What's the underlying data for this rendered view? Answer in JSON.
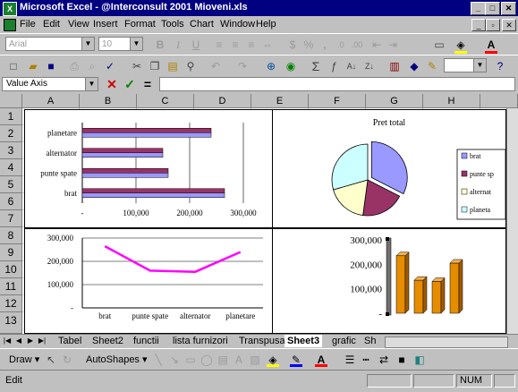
{
  "window": {
    "title": "Microsoft Excel - @Interconsult 2001 Mioveni.xls",
    "controls": [
      "minimize",
      "maximize",
      "close"
    ]
  },
  "menu": {
    "items": [
      "File",
      "Edit",
      "View",
      "Insert",
      "Format",
      "Tools",
      "Chart",
      "Window",
      "Help"
    ]
  },
  "formatting_toolbar": {
    "font": "Arial",
    "size": "10",
    "bold": "B",
    "italic": "I",
    "underline": "U",
    "currency": "$",
    "percent": "%",
    "comma": ","
  },
  "formula_bar": {
    "name_box": "Value Axis",
    "cancel": "✕",
    "enter": "✓",
    "equals": "=",
    "content": ""
  },
  "grid": {
    "columns": [
      "A",
      "B",
      "C",
      "D",
      "E",
      "F",
      "G",
      "H"
    ],
    "rows": [
      "1",
      "2",
      "3",
      "4",
      "5",
      "6",
      "7",
      "8",
      "9",
      "10",
      "11",
      "12",
      "13"
    ]
  },
  "chart_data": [
    {
      "type": "bar",
      "categories": [
        "brat",
        "punte spate",
        "alternator",
        "planetare"
      ],
      "series": [
        {
          "values": [
            265000,
            160000,
            150000,
            240000
          ],
          "color": "#993366"
        },
        {
          "values": [
            265000,
            160000,
            150000,
            240000
          ],
          "color": "#9999ff"
        }
      ],
      "xlim": [
        0,
        300000
      ],
      "xticks": [
        "-",
        "100,000",
        "200,000",
        "300,000"
      ],
      "grid": true
    },
    {
      "type": "pie",
      "title": "Pret total",
      "categories": [
        "brat",
        "punte spate",
        "alternator",
        "planetare"
      ],
      "legend_labels": [
        "brat",
        "punte sp",
        "alternat",
        "planeta"
      ],
      "values": [
        265000,
        160000,
        150000,
        240000
      ],
      "colors": [
        "#9999ff",
        "#993366",
        "#ffffcc",
        "#ccffff"
      ],
      "legend": "right"
    },
    {
      "type": "line",
      "categories": [
        "brat",
        "punte spate",
        "alternator",
        "planetare"
      ],
      "series": [
        {
          "values": [
            265000,
            160000,
            155000,
            240000
          ],
          "color": "#ff00ff"
        }
      ],
      "ylim": [
        0,
        300000
      ],
      "yticks": [
        "-",
        "100,000",
        "200,000",
        "300,000"
      ],
      "grid": true
    },
    {
      "type": "bar",
      "subtype": "3d-column",
      "values": [
        235000,
        135000,
        130000,
        205000
      ],
      "ylim": [
        0,
        300000
      ],
      "yticks": [
        "-",
        "100,000",
        "200,000",
        "300,000"
      ],
      "color": "#e58c00"
    }
  ],
  "sheet_tabs": {
    "tabs": [
      "Tabel",
      "Sheet2",
      "functii",
      "lista furnizori",
      "Transpusa",
      "Sheet3",
      "grafic",
      "Sh"
    ],
    "active": "Sheet3"
  },
  "drawing_toolbar": {
    "draw": "Draw",
    "autoshapes": "AutoShapes"
  },
  "status_bar": {
    "mode": "Edit",
    "num": "NUM"
  },
  "colors": {
    "titlebar": "#000080",
    "bar_front": "#993366",
    "bar_back": "#9999ff",
    "line": "#ff00ff",
    "column": "#e58c00"
  }
}
